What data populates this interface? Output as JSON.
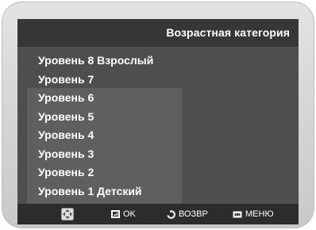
{
  "menu": {
    "title": "Возрастная категория",
    "items": [
      {
        "label": "Уровень 8 Взрослый"
      },
      {
        "label": "Уровень 7"
      },
      {
        "label": "Уровень 6"
      },
      {
        "label": "Уровень 5"
      },
      {
        "label": "Уровень 4"
      },
      {
        "label": "Уровень 3"
      },
      {
        "label": "Уровень 2"
      },
      {
        "label": "Уровень 1 Детский"
      }
    ]
  },
  "hints": {
    "navigate_icon": "dpad-arrows-icon",
    "ok_label": "OK",
    "ok_icon": "enter-key-icon",
    "return_label": "ВОЗВР",
    "return_icon": "return-arrow-icon",
    "menu_label": "МЕНЮ",
    "menu_icon": "menu-key-icon"
  },
  "colors": {
    "screen_bg": "#4e4e4e",
    "header_bg": "#373737",
    "selection_bg": "#5f5f5f",
    "footer_bg": "#2c2c2c",
    "text": "#ffffff"
  }
}
